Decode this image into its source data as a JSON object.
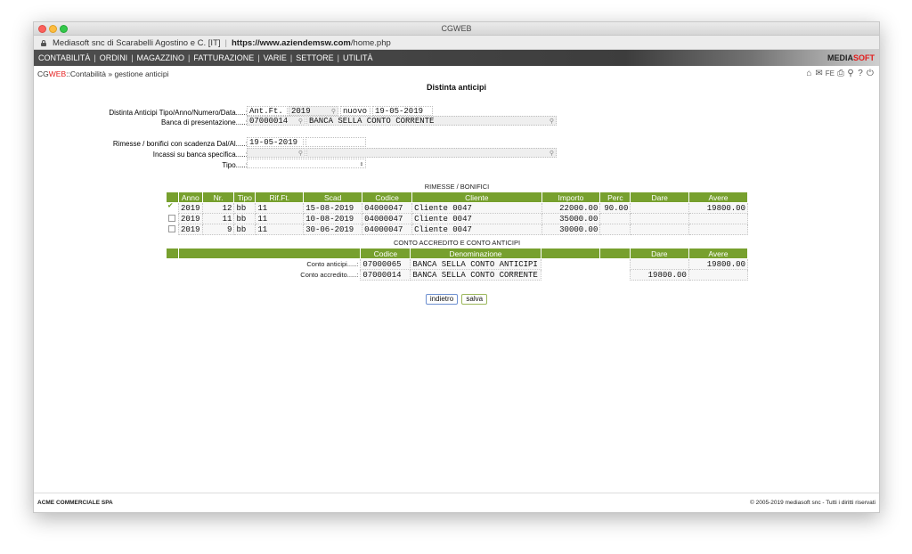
{
  "window": {
    "title": "CGWEB"
  },
  "urlbar": {
    "site": "Mediasoft snc di Scarabelli Agostino e C. [IT]",
    "url_host": "https://www.aziendemsw.com",
    "url_path": "/home.php"
  },
  "menu": {
    "items": [
      "CONTABILITÀ",
      "ORDINI",
      "MAGAZZINO",
      "FATTURAZIONE",
      "VARIE",
      "SETTORE",
      "UTILITÀ"
    ],
    "brand_a": "MEDIA",
    "brand_b": "SOFT"
  },
  "crumb": {
    "cg": "CG",
    "web": "WEB",
    "sep": " :: ",
    "path": "Contabilità » gestione anticipi"
  },
  "page_title": "Distinta anticipi",
  "form": {
    "tipo_label": "Distinta Anticipi Tipo/Anno/Numero/Data.....:",
    "tipo": "Ant.Ft.",
    "anno": "2019",
    "numero": "nuovo",
    "data": "19-05-2019",
    "banca_label": "Banca di presentazione.....:",
    "banca_codice": "07000014",
    "banca_nome": "BANCA SELLA CONTO CORRENTE",
    "scadenza_label": "Rimesse / bonifici con scadenza Dal/Al.....:",
    "scadenza_dal": "19-05-2019",
    "scadenza_al": "",
    "incassi_label": "Incassi su banca specifica.....:",
    "tipo2_label": "Tipo.....:"
  },
  "rimesse": {
    "title": "RIMESSE / BONIFICI",
    "headers": [
      "Anno",
      "Nr.",
      "Tipo",
      "Rif.Ft.",
      "Scad",
      "Codice",
      "Cliente",
      "Importo",
      "Perc",
      "Dare",
      "Avere"
    ],
    "rows": [
      {
        "checked": true,
        "anno": "2019",
        "nr": "12",
        "tipo": "bb",
        "rif": "11",
        "scad": "15-08-2019",
        "codice": "04000047",
        "cliente": "Cliente 0047",
        "importo": "22000.00",
        "perc": "90.00",
        "dare": "",
        "avere": "19800.00"
      },
      {
        "checked": false,
        "anno": "2019",
        "nr": "11",
        "tipo": "bb",
        "rif": "11",
        "scad": "10-08-2019",
        "codice": "04000047",
        "cliente": "Cliente 0047",
        "importo": "35000.00",
        "perc": "",
        "dare": "",
        "avere": ""
      },
      {
        "checked": false,
        "anno": "2019",
        "nr": "9",
        "tipo": "bb",
        "rif": "11",
        "scad": "30-06-2019",
        "codice": "04000047",
        "cliente": "Cliente 0047",
        "importo": "30000.00",
        "perc": "",
        "dare": "",
        "avere": ""
      }
    ]
  },
  "conti": {
    "title": "CONTO ACCREDITO E CONTO ANTICIPI",
    "headers": [
      "Codice",
      "Denominazione",
      "Dare",
      "Avere"
    ],
    "rows": [
      {
        "label": "Conto anticipi.....:",
        "codice": "07000065",
        "denominazione": "BANCA SELLA CONTO ANTICIPI",
        "dare": "",
        "avere": "19800.00"
      },
      {
        "label": "Conto accredito.....:",
        "codice": "07000014",
        "denominazione": "BANCA SELLA CONTO CORRENTE",
        "dare": "19800.00",
        "avere": ""
      }
    ]
  },
  "buttons": {
    "back": "indietro",
    "save": "salva"
  },
  "footer": {
    "company": "ACME COMMERCIALE SPA",
    "copyright": "© 2005-2019 mediasoft snc - Tutti i diritti riservati"
  },
  "toolbar_icons": [
    "home-icon",
    "mail-icon",
    "fe-icon",
    "print-icon",
    "search-icon",
    "help-icon",
    "power-icon"
  ],
  "colors": {
    "accent_green": "#77a02e",
    "brand_red": "#e31b1b",
    "menubar": "#3d3d3d"
  }
}
